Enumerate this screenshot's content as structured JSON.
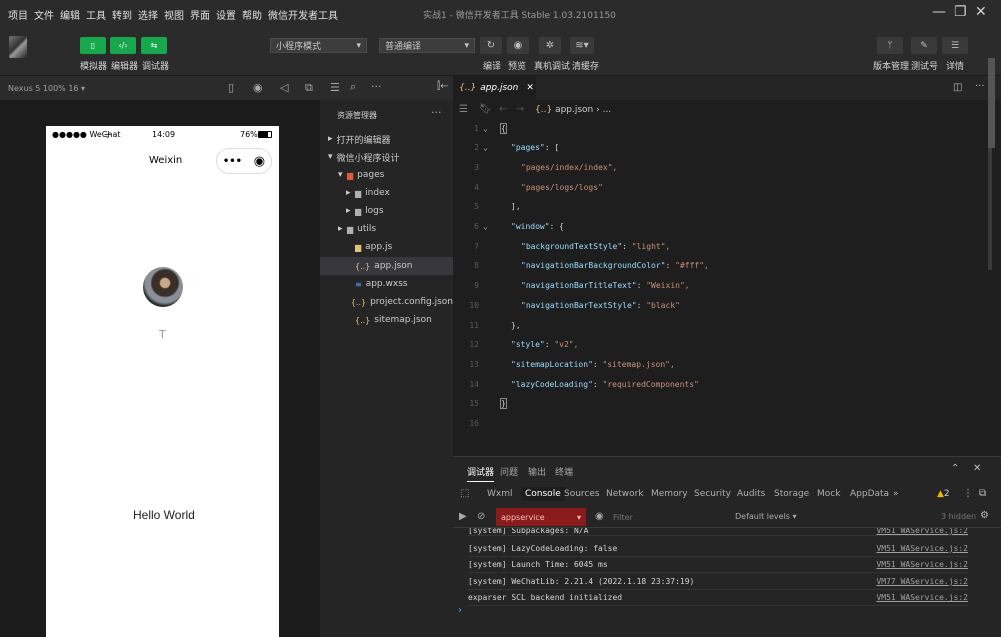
{
  "menu": [
    "项目",
    "文件",
    "编辑",
    "工具",
    "转到",
    "选择",
    "视图",
    "界面",
    "设置",
    "帮助",
    "微信开发者工具"
  ],
  "window_title": "实战1 - 微信开发者工具 Stable 1.03.2101150",
  "toolbar": {
    "simulator_label": "模拟器",
    "editor_label": "编辑器",
    "debugger_label": "调试器",
    "mode_select": "小程序模式",
    "compile_select": "普通编译",
    "compile_label": "编译",
    "preview_label": "预览",
    "realdevice_label": "真机调试",
    "clearcache_label": "清缓存",
    "version_label": "版本管理",
    "testid_label": "测试号",
    "details_label": "详情"
  },
  "sim_status": "Nexus 5 100% 16 ▾",
  "phone": {
    "carrier": "●●●●● WeChat",
    "time": "14:09",
    "battery": "76%",
    "nav_title": "Weixin",
    "nickname": "T",
    "hello": "Hello World"
  },
  "explorer": {
    "title": "资源管理器",
    "open_editors": "打开的编辑器",
    "project": "微信小程序设计",
    "items": [
      {
        "name": "pages",
        "icon": "folder-pages-icon"
      },
      {
        "name": "index",
        "icon": "folder-icon"
      },
      {
        "name": "logs",
        "icon": "folder-icon"
      },
      {
        "name": "utils",
        "icon": "folder-icon"
      },
      {
        "name": "app.js",
        "icon": "js-file-icon"
      },
      {
        "name": "app.json",
        "icon": "json-file-icon"
      },
      {
        "name": "app.wxss",
        "icon": "css-file-icon"
      },
      {
        "name": "project.config.json",
        "icon": "json-file-icon"
      },
      {
        "name": "sitemap.json",
        "icon": "json-file-icon"
      }
    ]
  },
  "editor": {
    "tab": "app.json",
    "breadcrumb": "app.json",
    "lines": [
      {
        "n": "1",
        "t": "{"
      },
      {
        "n": "2",
        "k": "\"pages\"",
        "v": "["
      },
      {
        "n": "3",
        "s": "\"pages/index/index\","
      },
      {
        "n": "4",
        "s": "\"pages/logs/logs\""
      },
      {
        "n": "5",
        "t": "],"
      },
      {
        "n": "6",
        "k": "\"window\"",
        "v": "{"
      },
      {
        "n": "7",
        "k": "\"backgroundTextStyle\"",
        "s": "\"light\","
      },
      {
        "n": "8",
        "k": "\"navigationBarBackgroundColor\"",
        "s": "\"#fff\","
      },
      {
        "n": "9",
        "k": "\"navigationBarTitleText\"",
        "s": "\"Weixin\","
      },
      {
        "n": "10",
        "k": "\"navigationBarTextStyle\"",
        "s": "\"black\""
      },
      {
        "n": "11",
        "t": "},"
      },
      {
        "n": "12",
        "k": "\"style\"",
        "s": "\"v2\","
      },
      {
        "n": "13",
        "k": "\"sitemapLocation\"",
        "s": "\"sitemap.json\","
      },
      {
        "n": "14",
        "k": "\"lazyCodeLoading\"",
        "s": "\"requiredComponents\""
      },
      {
        "n": "15",
        "t": "}"
      },
      {
        "n": "16",
        "t": ""
      }
    ]
  },
  "debug": {
    "tabs": [
      "调试器",
      "问题",
      "输出",
      "终端"
    ],
    "console_tabs": [
      "Wxml",
      "Console",
      "Sources",
      "Network",
      "Memory",
      "Security",
      "Audits",
      "Storage",
      "Mock",
      "AppData",
      "»"
    ],
    "warn_count": "2",
    "context": "appservice",
    "filter_placeholder": "Filter",
    "levels": "Default levels ▾",
    "hidden": "3 hidden",
    "logs": [
      {
        "text": "[system] Subpackages: N/A",
        "link": "VM51 WAService.js:2"
      },
      {
        "text": "[system] LazyCodeLoading: false",
        "link": "VM51 WAService.js:2"
      },
      {
        "text": "[system] Launch Time: 6045 ms",
        "link": "VM51 WAService.js:2"
      },
      {
        "text": "[system] WeChatLib: 2.21.4 (2022.1.18 23:37:19)",
        "link": "VM77 WAService.js:2"
      },
      {
        "text": "exparser SCL backend initialized",
        "link": "VM51 WAService.js:2"
      }
    ],
    "prompt": "›"
  },
  "colors": {
    "accent_green": "#17a84e",
    "context_red": "#8b1a1a"
  }
}
